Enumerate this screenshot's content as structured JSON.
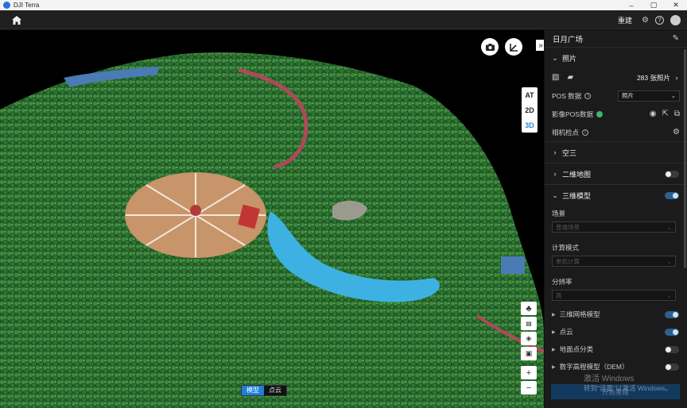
{
  "app": {
    "title": "DJI Terra"
  },
  "window": {
    "minimize": "–",
    "maximize": "▢",
    "close": "✕"
  },
  "topbar": {
    "rebuild_label": "重建"
  },
  "map": {
    "view_modes": [
      "AT",
      "2D",
      "3D"
    ],
    "active_view": "3D",
    "render_modes": [
      "模型",
      "点云"
    ],
    "active_render": "模型",
    "zoom_in": "+",
    "zoom_out": "−",
    "collapse_label": "»"
  },
  "panel": {
    "project_name": "日月广场",
    "photos": {
      "title": "照片",
      "count_label": "283 张照片",
      "pos_label": "POS 数据",
      "pos_select": "照片",
      "image_pos_label": "影像POS数据",
      "camera_label": "相机检点"
    },
    "air_triangulation": {
      "title": "空三"
    },
    "map2d": {
      "title": "二维地图",
      "enabled": false
    },
    "model3d": {
      "title": "三维模型",
      "enabled": true,
      "scene_label": "场景",
      "scene_value": "普通场景",
      "compute_label": "计算模式",
      "compute_value": "单机计算",
      "resolution_label": "分辨率",
      "resolution_value": "高",
      "sub_items": [
        {
          "label": "三维网格模型",
          "enabled": true
        },
        {
          "label": "点云",
          "enabled": true
        },
        {
          "label": "地面点分类",
          "enabled": false
        },
        {
          "label": "数字高程模型（DEM）",
          "enabled": false
        }
      ]
    },
    "start_button": "开始重建"
  },
  "watermark": {
    "line1": "激活 Windows",
    "line2": "转到\"设置\"以激活 Windows。"
  },
  "colors": {
    "accent": "#1f7fdc",
    "panel_bg": "#1b1b1b",
    "toggle_on": "#2e5f8f"
  }
}
